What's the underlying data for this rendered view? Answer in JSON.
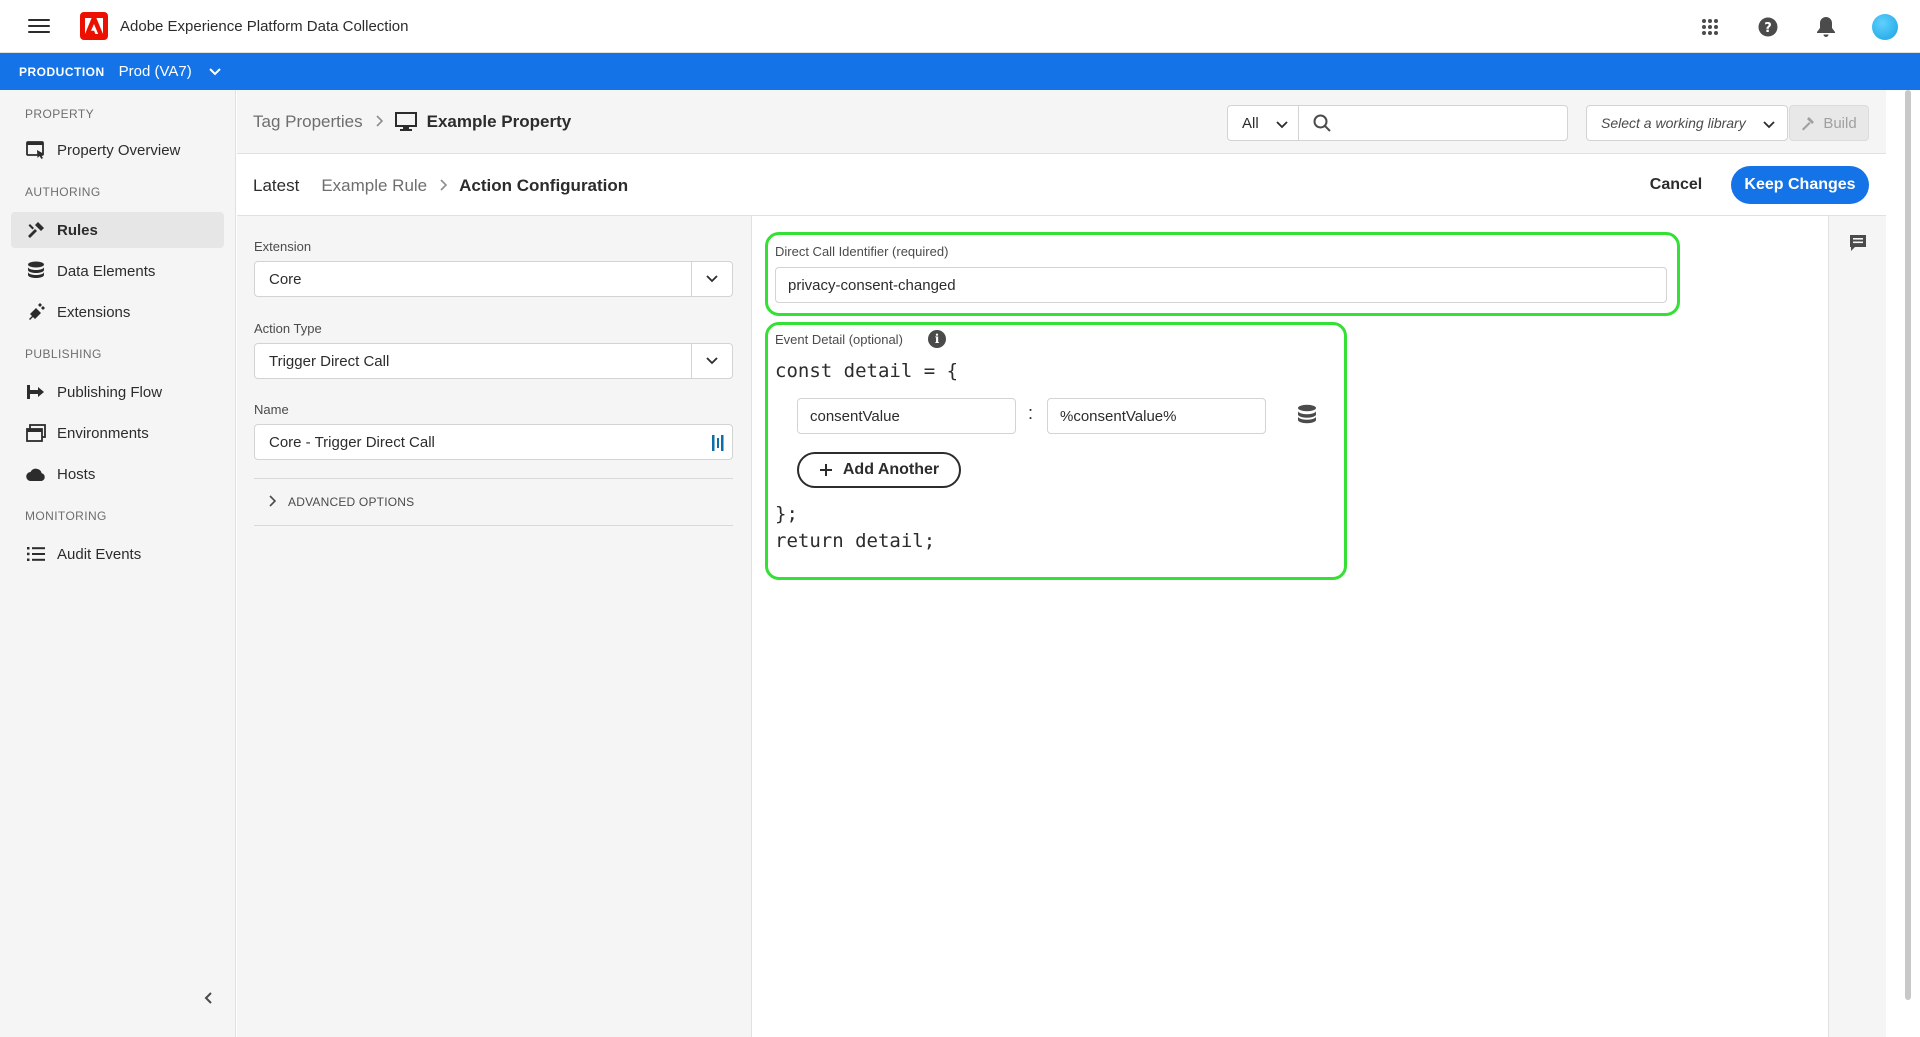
{
  "app": {
    "title": "Adobe Experience Platform Data Collection"
  },
  "environment": {
    "label": "PRODUCTION",
    "value": "Prod (VA7)"
  },
  "sidebar": {
    "sections": {
      "property": "PROPERTY",
      "authoring": "AUTHORING",
      "publishing": "PUBLISHING",
      "monitoring": "MONITORING"
    },
    "items": {
      "property_overview": "Property Overview",
      "rules": "Rules",
      "data_elements": "Data Elements",
      "extensions": "Extensions",
      "publishing_flow": "Publishing Flow",
      "environments": "Environments",
      "hosts": "Hosts",
      "audit_events": "Audit Events"
    },
    "active_item": "Rules"
  },
  "header": {
    "breadcrumb_root": "Tag Properties",
    "property_name": "Example Property",
    "filter": {
      "value": "All"
    },
    "search": {
      "value": "",
      "placeholder": ""
    },
    "library": {
      "placeholder": "Select a working library"
    },
    "build_label": "Build"
  },
  "subheader": {
    "crumbs": [
      "Latest",
      "Example Rule",
      "Action Configuration"
    ],
    "cancel_label": "Cancel",
    "keep_label": "Keep Changes"
  },
  "form": {
    "extension": {
      "label": "Extension",
      "value": "Core"
    },
    "action_type": {
      "label": "Action Type",
      "value": "Trigger Direct Call"
    },
    "name": {
      "label": "Name",
      "value": "Core - Trigger Direct Call"
    },
    "advanced_label": "ADVANCED OPTIONS"
  },
  "config": {
    "identifier": {
      "label": "Direct Call Identifier (required)",
      "value": "privacy-consent-changed"
    },
    "event_detail": {
      "label": "Event Detail (optional)",
      "code_open": "const detail = {",
      "key": "consentValue",
      "value": "%consentValue%",
      "colon": ":",
      "add_label": "Add Another",
      "code_close": "};",
      "code_return": "return detail;"
    }
  },
  "colors": {
    "accent": "#1473e6",
    "highlight": "#34e034",
    "adobe_red": "#eb1000"
  },
  "icons": {
    "menu": "hamburger-menu-icon",
    "apps": "app-grid-icon",
    "help": "help-icon",
    "notifications": "bell-icon",
    "property_overview": "property-overview-icon",
    "rules": "rules-icon",
    "data_elements": "data-elements-icon",
    "extensions": "extensions-icon",
    "publishing_flow": "publishing-flow-icon",
    "environments": "environments-icon",
    "hosts": "cloud-icon",
    "audit_events": "list-icon",
    "property": "monitor-icon",
    "comment": "comment-icon"
  }
}
